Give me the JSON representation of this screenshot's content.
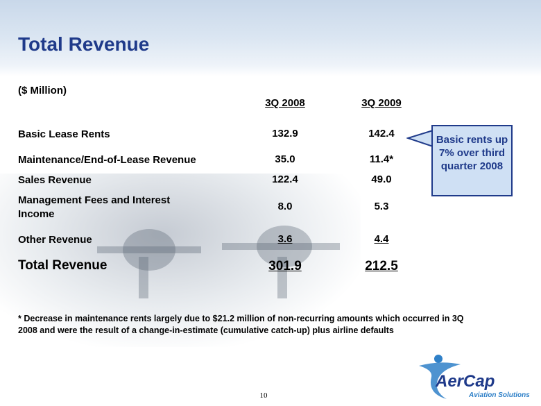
{
  "title": "Total Revenue",
  "unit_label": "($ Million)",
  "columns": [
    "3Q 2008",
    "3Q 2009"
  ],
  "rows": [
    {
      "label": "Basic Lease Rents",
      "v1": "132.9",
      "v2": "142.4"
    },
    {
      "label": "Maintenance/End-of-Lease Revenue",
      "v1": "35.0",
      "v2": "11.4*"
    },
    {
      "label": "Sales Revenue",
      "v1": "122.4",
      "v2": "49.0"
    },
    {
      "label": "Management Fees and Interest Income",
      "v1": "8.0",
      "v2": "5.3"
    },
    {
      "label": "Other Revenue",
      "v1": "3.6",
      "v2": "4.4"
    }
  ],
  "total": {
    "label": "Total Revenue",
    "v1": "301.9",
    "v2": "212.5"
  },
  "callout": "Basic rents up 7% over third quarter 2008",
  "footnote": "* Decrease in maintenance rents largely due to $21.2 million of non-recurring amounts which occurred in 3Q 2008 and were the result of a change-in-estimate (cumulative catch-up) plus airline defaults",
  "page_number": "10",
  "logo": {
    "name": "AerCap",
    "tagline": "Aviation Solutions",
    "icon": "aercap-swoosh-icon"
  },
  "colors": {
    "title": "#1f3a8a",
    "callout_bg": "#cfe0f4",
    "callout_border": "#1f3a8a"
  }
}
